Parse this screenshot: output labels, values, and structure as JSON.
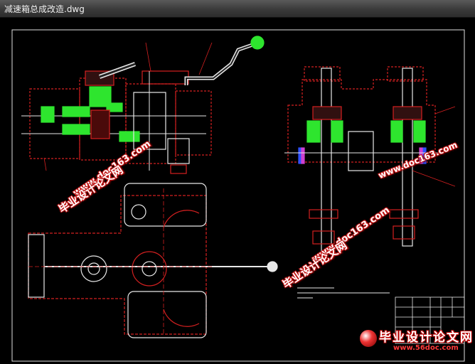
{
  "window": {
    "title": "减速箱总成改造.dwg"
  },
  "watermarks": {
    "site_cn": "毕业设计论文网",
    "site_url": "www.doc163.com",
    "site_url_2": "www.doc163.com",
    "site_cn_2": "毕业设计论文网",
    "site_url_3": "www.doc163.com"
  },
  "logo": {
    "text": "毕业设计论文网",
    "url": "www.56doc.com"
  },
  "colors": {
    "outline": "#d42020",
    "fill_green": "#2ee52e",
    "white_line": "#e8e8e8",
    "magenta": "#d040d0",
    "blue": "#3050ff",
    "frame": "#e0e0e0"
  }
}
